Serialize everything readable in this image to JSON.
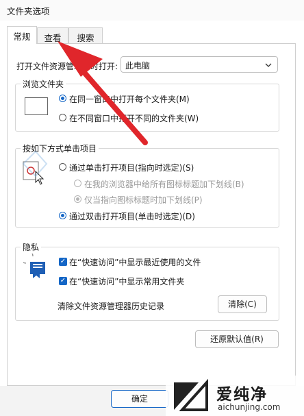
{
  "window": {
    "title": "文件夹选项"
  },
  "tabs": [
    {
      "label": "常规"
    },
    {
      "label": "查看"
    },
    {
      "label": "搜索"
    }
  ],
  "open_explorer": {
    "label": "打开文件资源管理器时打开:",
    "value": "此电脑"
  },
  "browse_folders": {
    "title": "浏览文件夹",
    "options": [
      {
        "label": "在同一窗口中打开每个文件夹(M)",
        "selected": true
      },
      {
        "label": "在不同窗口中打开不同的文件夹(W)",
        "selected": false
      }
    ]
  },
  "click_items": {
    "title": "按如下方式单击项目",
    "single_click": "通过单击打开项目(指向时选定)(S)",
    "underline_all": "在我的浏览器中给所有图标标题加下划线(B)",
    "underline_hover": "仅当指向图标标题时加下划线(P)",
    "double_click": "通过双击打开项目(单击时选定)(D)"
  },
  "privacy": {
    "title": "隐私",
    "recent_files": "在“快速访问”中显示最近使用的文件",
    "frequent_folders": "在“快速访问”中显示常用文件夹",
    "clear_label": "清除文件资源管理器历史记录",
    "clear_button": "清除(C)"
  },
  "restore_defaults": "还原默认值(R)",
  "ok_button": "确定",
  "watermark": {
    "brand": "爱纯净",
    "url": "aichunjing.com"
  },
  "colors": {
    "accent": "#1466c6",
    "arrow": "#e0262b"
  }
}
